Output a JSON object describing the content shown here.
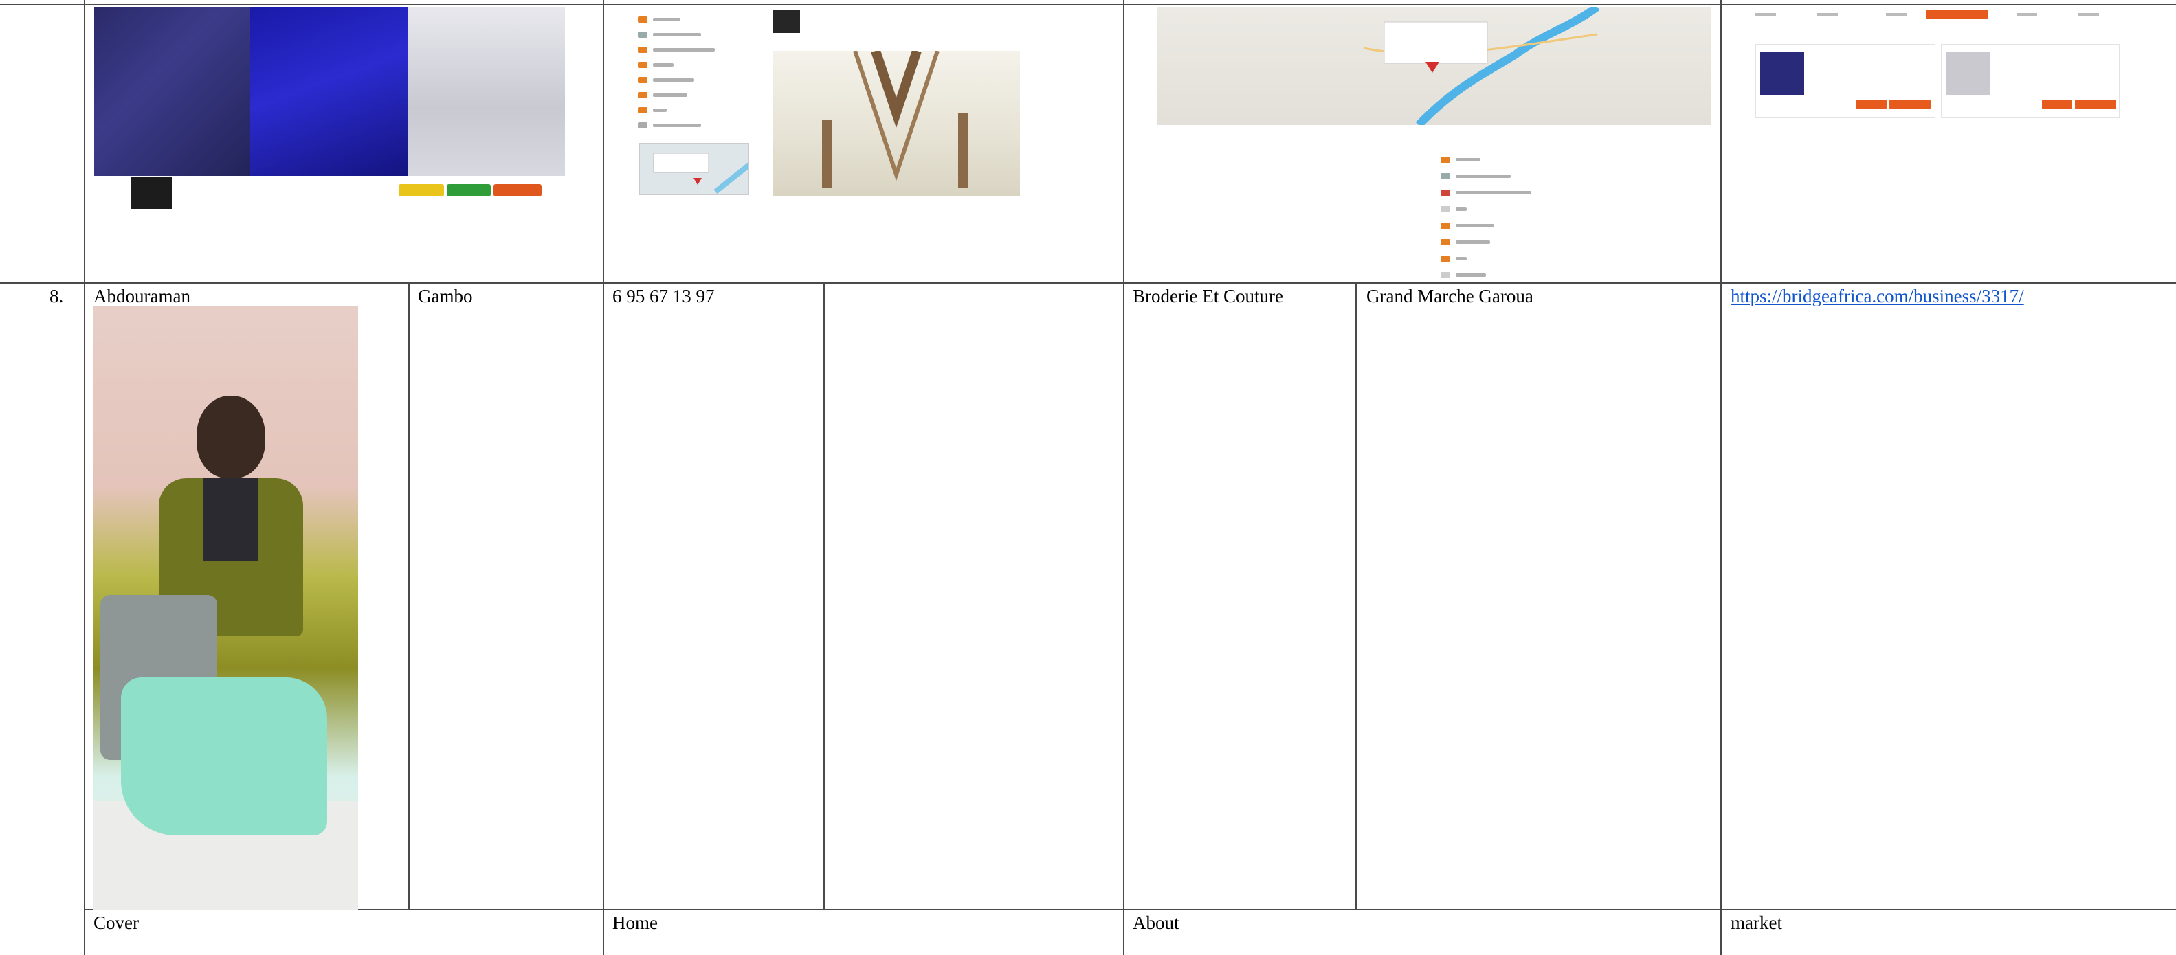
{
  "table": {
    "row_number": "8.",
    "first_name": "Abdouraman",
    "last_name": "Gambo",
    "phone": "6 95 67 13 97",
    "category": "Broderie Et Couture",
    "address": "Grand Marche Garoua",
    "url": "https://bridgeafrica.com/business/3317/",
    "footer_labels": {
      "cover": "Cover",
      "home": "Home",
      "about": "About",
      "market": "market"
    }
  }
}
